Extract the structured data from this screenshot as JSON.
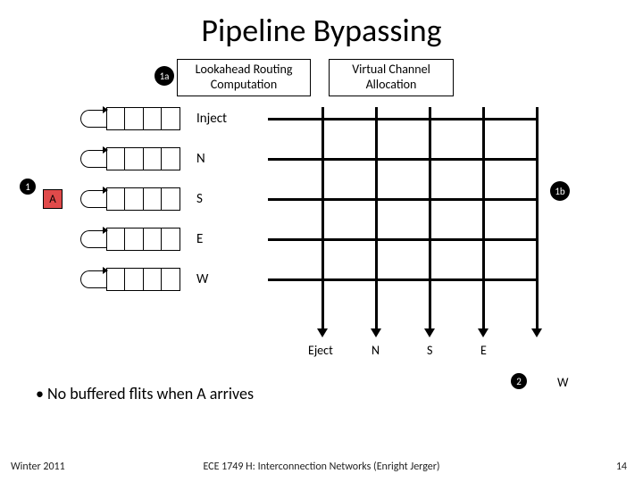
{
  "title": "Pipeline Bypassing",
  "stages": {
    "left": "Lookahead Routing\nComputation",
    "right": "Virtual Channel\nAllocation"
  },
  "badges": {
    "b1": "1",
    "b1a": "1a",
    "b1b": "1b",
    "b2": "2"
  },
  "ports": {
    "inject": "Inject",
    "n": "N",
    "s": "S",
    "e": "E",
    "w": "W",
    "eject": "Eject"
  },
  "flit": {
    "label": "A"
  },
  "outputs": {
    "eject": "Eject",
    "n": "N",
    "s": "S",
    "e": "E",
    "w": "W"
  },
  "bullet": "•  No buffered flits when A arrives",
  "footer": {
    "left": "Winter 2011",
    "center": "ECE 1749 H: Interconnection Networks (Enright Jerger)",
    "right": "14"
  }
}
